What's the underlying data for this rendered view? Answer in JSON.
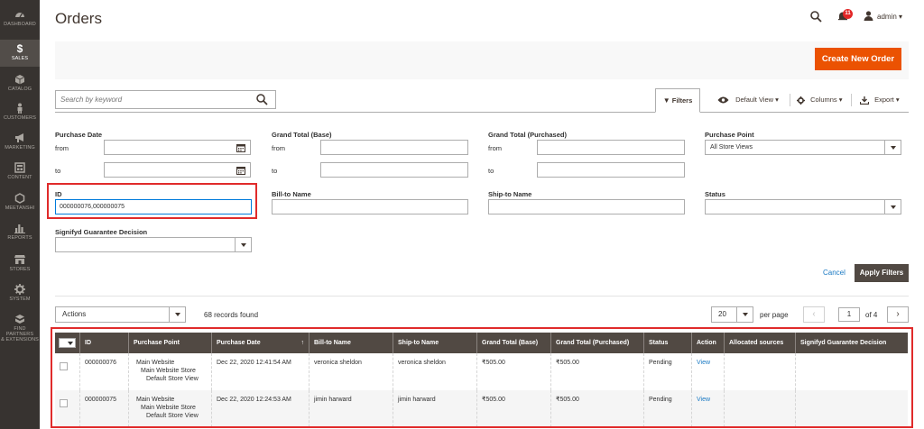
{
  "sidebar": {
    "items": [
      {
        "label": "DASHBOARD",
        "icon": "dashboard-icon"
      },
      {
        "label": "SALES",
        "icon": "dollar-icon"
      },
      {
        "label": "CATALOG",
        "icon": "cube-icon"
      },
      {
        "label": "CUSTOMERS",
        "icon": "person-icon"
      },
      {
        "label": "MARKETING",
        "icon": "megaphone-icon"
      },
      {
        "label": "CONTENT",
        "icon": "layout-icon"
      },
      {
        "label": "MEETANSHI",
        "icon": "hexagon-icon"
      },
      {
        "label": "REPORTS",
        "icon": "bar-chart-icon"
      },
      {
        "label": "STORES",
        "icon": "store-icon"
      },
      {
        "label": "SYSTEM",
        "icon": "gear-icon"
      },
      {
        "label": "FIND PARTNERS",
        "label2": "& EXTENSIONS",
        "icon": "blocks-icon"
      }
    ]
  },
  "header": {
    "title": "Orders",
    "notifications_count": "11",
    "user": "admin"
  },
  "actions": {
    "create_label": "Create New Order"
  },
  "toolbar": {
    "search_placeholder": "Search by keyword",
    "filters_label": "Filters",
    "view_label": "Default View",
    "columns_label": "Columns",
    "export_label": "Export"
  },
  "filters": {
    "purchase_date": "Purchase Date",
    "grand_total_base": "Grand Total (Base)",
    "grand_total_purchased": "Grand Total (Purchased)",
    "purchase_point": "Purchase Point",
    "purchase_point_value": "All Store Views",
    "from": "from",
    "to": "to",
    "id": "ID",
    "id_value": "000000076,000000075",
    "bill_to": "Bill-to Name",
    "ship_to": "Ship-to Name",
    "status": "Status",
    "signifyd": "Signifyd Guarantee Decision",
    "cancel_label": "Cancel",
    "apply_label": "Apply Filters"
  },
  "grid": {
    "actions_label": "Actions",
    "records": "68 records found",
    "per_page_value": "20",
    "per_page_label": "per page",
    "page": "1",
    "of_pages": "of 4",
    "columns": [
      "ID",
      "Purchase Point",
      "Purchase Date",
      "Bill-to Name",
      "Ship-to Name",
      "Grand Total (Base)",
      "Grand Total (Purchased)",
      "Status",
      "Action",
      "Allocated sources",
      "Signifyd Guarantee Decision"
    ],
    "sort_indicator": "↑",
    "rows": [
      {
        "id": "000000076",
        "pp1": "Main Website",
        "pp2": "Main Website Store",
        "pp3": "Default Store View",
        "date": "Dec 22, 2020 12:41:54 AM",
        "bill": "veronica sheldon",
        "ship": "veronica sheldon",
        "base": "₹505.00",
        "purchased": "₹505.00",
        "status": "Pending",
        "action": "View"
      },
      {
        "id": "000000075",
        "pp1": "Main Website",
        "pp2": "Main Website Store",
        "pp3": "Default Store View",
        "date": "Dec 22, 2020 12:24:53 AM",
        "bill": "jimin harward",
        "ship": "jimin harward",
        "base": "₹505.00",
        "purchased": "₹505.00",
        "status": "Pending",
        "action": "View"
      }
    ]
  },
  "colors": {
    "sidebar": "#373330",
    "accent": "#eb5202",
    "header_row": "#514943",
    "link": "#1979c3",
    "highlight": "#e02b2b"
  }
}
